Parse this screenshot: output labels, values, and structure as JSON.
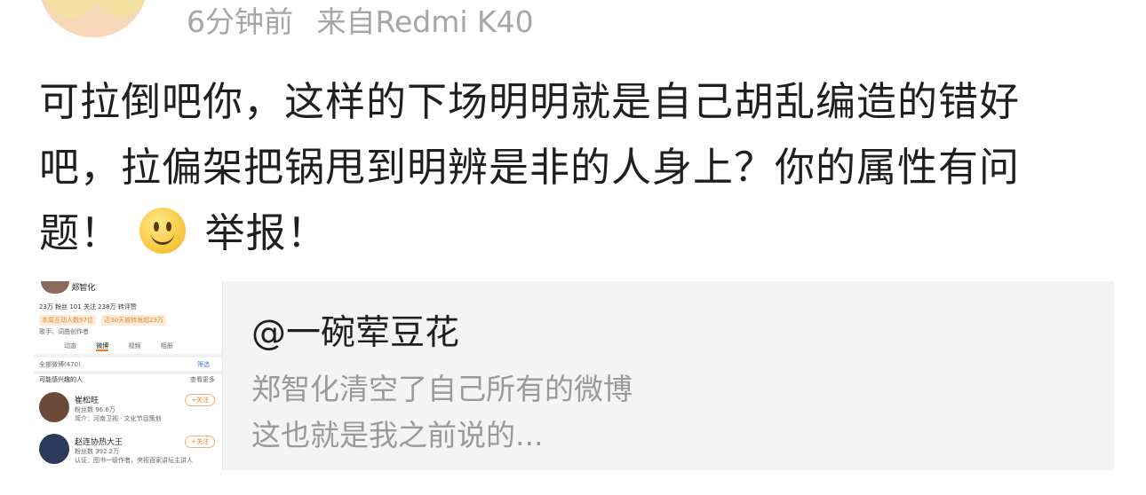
{
  "header": {
    "avatar_icon": "user-avatar-cartoon",
    "time": "6分钟前",
    "source": "来自Redmi K40"
  },
  "post": {
    "text_before_emoji": "可拉倒吧你，这样的下场明明就是自己胡乱编造的错好吧，拉偏架把锅甩到明辨是非的人身上？你的属性有问题！",
    "emoji_icon": "smile-emoji",
    "text_after_emoji": "举报！"
  },
  "card": {
    "title": "@一碗荤豆花",
    "desc_line1": "郑智化清空了自己所有的微博",
    "desc_line2": "这也就是我之前说的...",
    "thumbnail": {
      "profile_name": "郑智化",
      "stats": "23万 粉丝   101 关注   238万 转评赞",
      "pill1": "本周互动人数97位",
      "pill2": "近30天被转发超23万",
      "bio": "歌手、词曲创作者",
      "tabs": [
        "动态",
        "微博",
        "视频",
        "相册"
      ],
      "all_weibo": "全部微博(470)",
      "filter": "筛选",
      "maybe_like": "可能感兴趣的人",
      "see_more": "查看更多",
      "user1_name": "崔松旺",
      "user1_fans": "粉丝数 96.6万",
      "user1_bio": "简介：河南卫视 · 文化节目策划",
      "user2_name": "赵连协热大王",
      "user2_fans": "粉丝数 392.2万",
      "user2_bio": "认证：图书一级作者，央视百家讲坛主讲人",
      "follow_label": "+关注"
    }
  }
}
